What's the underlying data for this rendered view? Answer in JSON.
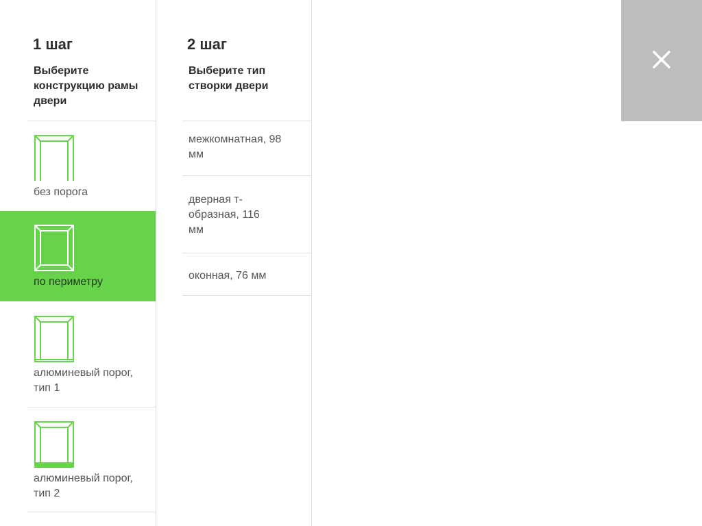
{
  "step1": {
    "title": "1 шаг",
    "subtitle": "Выберите конструкцию рамы двери",
    "items": [
      {
        "label": "без порога",
        "selected": false,
        "icon": "frame-no-threshold-icon"
      },
      {
        "label": "по периметру",
        "selected": true,
        "icon": "frame-perimeter-icon"
      },
      {
        "label": "алюминевый порог, тип 1",
        "selected": false,
        "icon": "frame-alu-threshold-1-icon"
      },
      {
        "label": "алюминевый порог, тип 2",
        "selected": false,
        "icon": "frame-alu-threshold-2-icon"
      }
    ]
  },
  "step2": {
    "title": "2 шаг",
    "subtitle": "Выберите тип створки двери",
    "items": [
      {
        "label": "межкомнатная, 98 мм"
      },
      {
        "label": "дверная т-образная, 116 мм"
      },
      {
        "label": "оконная, 76 мм"
      }
    ]
  },
  "close": {
    "icon": "close-icon"
  },
  "colors": {
    "accent": "#66d34a",
    "close_bg": "#bdbdbd",
    "divider": "#dcdcdc"
  }
}
